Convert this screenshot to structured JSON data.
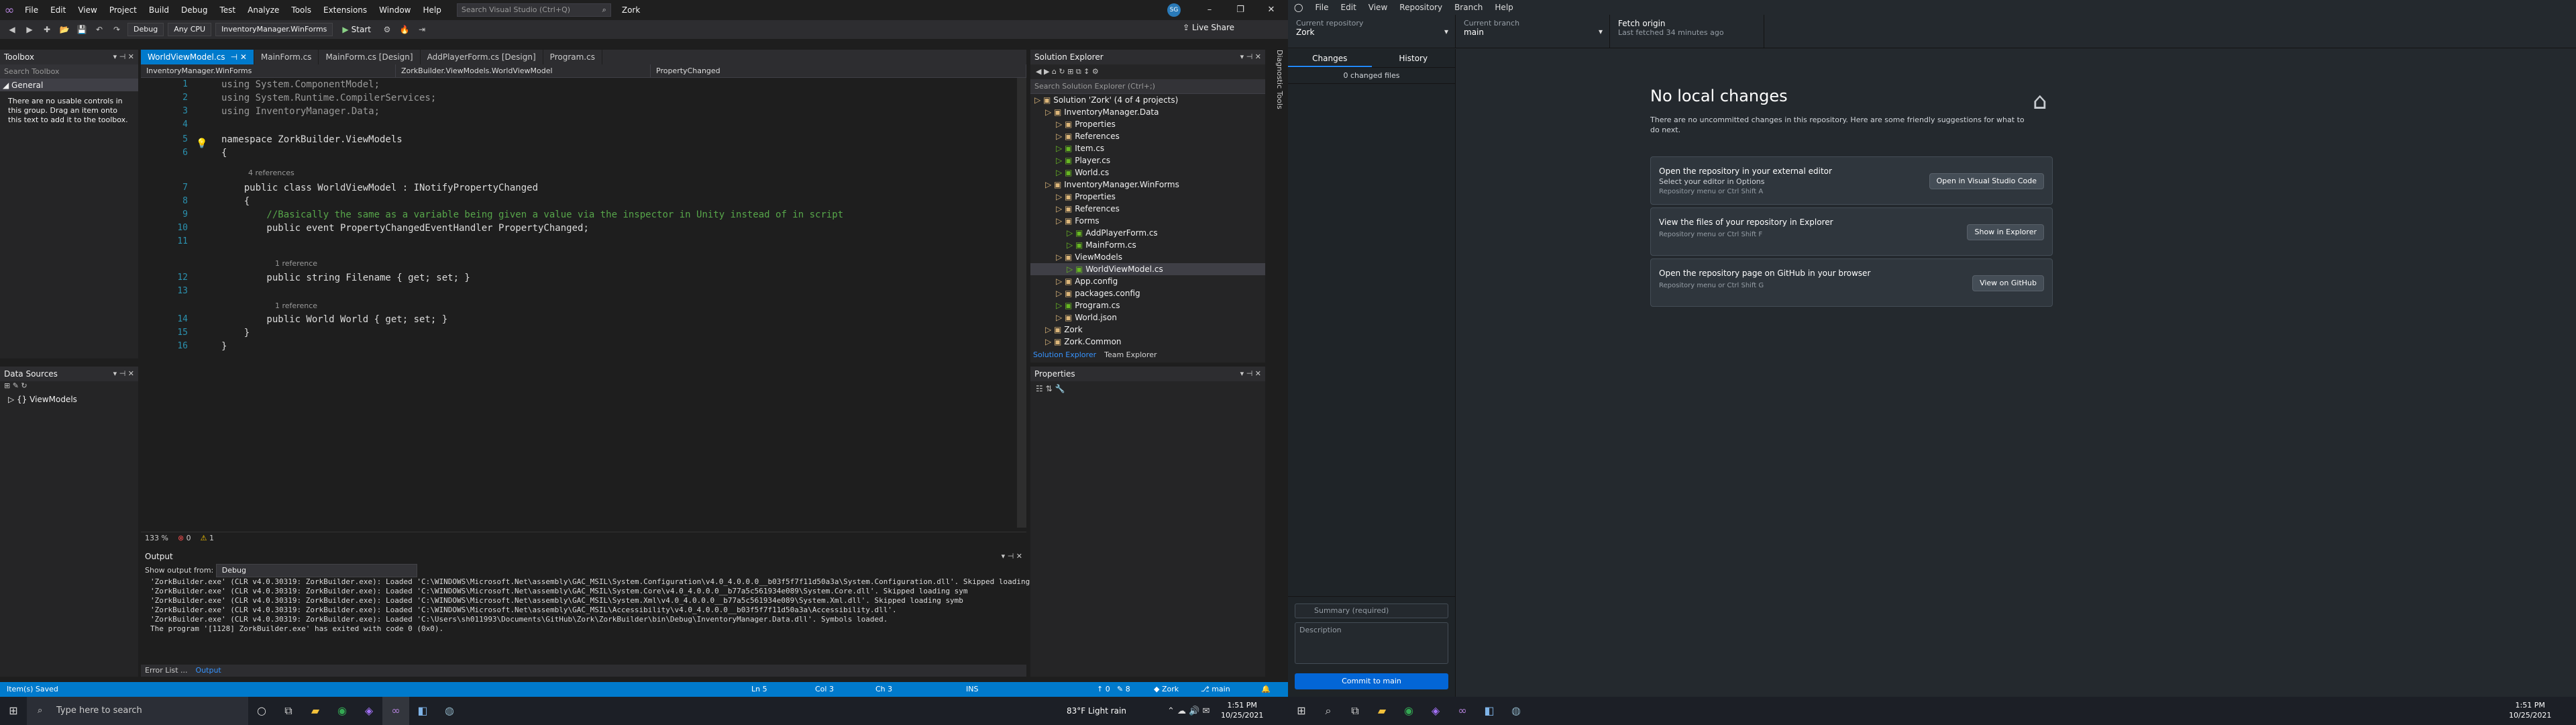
{
  "vs": {
    "menu": [
      "File",
      "Edit",
      "View",
      "Project",
      "Build",
      "Debug",
      "Test",
      "Analyze",
      "Tools",
      "Extensions",
      "Window",
      "Help"
    ],
    "search_placeholder": "Search Visual Studio (Ctrl+Q)",
    "solution_name": "Zork",
    "avatar_initials": "SG",
    "toolbar": {
      "config": "Debug",
      "platform": "Any CPU",
      "startup": "InventoryManager.WinForms",
      "start": "Start",
      "live_share": "Live Share"
    },
    "toolbox": {
      "title": "Toolbox",
      "search": "Search Toolbox",
      "group": "General",
      "empty": "There are no usable controls in this group. Drag an item onto this text to add it to the toolbox."
    },
    "data_sources": {
      "title": "Data Sources",
      "item": "ViewModels"
    },
    "tabs": [
      "WorldViewModel.cs",
      "MainForm.cs",
      "MainForm.cs [Design]",
      "AddPlayerForm.cs [Design]",
      "Program.cs"
    ],
    "nav": {
      "project": "InventoryManager.WinForms",
      "class": "ZorkBuilder.ViewModels.WorldViewModel",
      "member": "PropertyChanged"
    },
    "code": [
      {
        "n": "1",
        "t": "using System.ComponentModel;"
      },
      {
        "n": "2",
        "t": "using System.Runtime.CompilerServices;"
      },
      {
        "n": "3",
        "t": "using InventoryManager.Data;"
      },
      {
        "n": "4",
        "t": ""
      },
      {
        "n": "5",
        "t": "namespace ZorkBuilder.ViewModels"
      },
      {
        "n": "6",
        "t": "{"
      },
      {
        "n": "7",
        "t": "    public class WorldViewModel : INotifyPropertyChanged"
      },
      {
        "n": "8",
        "t": "    {"
      },
      {
        "n": "9",
        "t": "        //Basically the same as a variable being given a value via the inspector in Unity instead of in script"
      },
      {
        "n": "10",
        "t": "        public event PropertyChangedEventHandler PropertyChanged;"
      },
      {
        "n": "11",
        "t": ""
      },
      {
        "n": "12",
        "t": "        public string Filename { get; set; }"
      },
      {
        "n": "13",
        "t": ""
      },
      {
        "n": "14",
        "t": "        public World World { get; set; }"
      },
      {
        "n": "15",
        "t": "    }"
      },
      {
        "n": "16",
        "t": "}"
      }
    ],
    "codelens": {
      "refs4": "4 references",
      "ref1a": "1 reference",
      "ref1b": "1 reference"
    },
    "editor_status": {
      "zoom": "133 %",
      "errors": "0",
      "warnings": "1"
    },
    "output": {
      "title": "Output",
      "show_from": "Show output from:",
      "source": "Debug",
      "lines": [
        "'ZorkBuilder.exe' (CLR v4.0.30319: ZorkBuilder.exe): Loaded 'C:\\WINDOWS\\Microsoft.Net\\assembly\\GAC_MSIL\\System.Configuration\\v4.0_4.0.0.0__b03f5f7f11d50a3a\\System.Configuration.dll'. Skipped loading s",
        "'ZorkBuilder.exe' (CLR v4.0.30319: ZorkBuilder.exe): Loaded 'C:\\WINDOWS\\Microsoft.Net\\assembly\\GAC_MSIL\\System.Core\\v4.0_4.0.0.0__b77a5c561934e089\\System.Core.dll'. Skipped loading sym",
        "'ZorkBuilder.exe' (CLR v4.0.30319: ZorkBuilder.exe): Loaded 'C:\\WINDOWS\\Microsoft.Net\\assembly\\GAC_MSIL\\System.Xml\\v4.0_4.0.0.0__b77a5c561934e089\\System.Xml.dll'. Skipped loading symb",
        "'ZorkBuilder.exe' (CLR v4.0.30319: ZorkBuilder.exe): Loaded 'C:\\WINDOWS\\Microsoft.Net\\assembly\\GAC_MSIL\\Accessibility\\v4.0_4.0.0.0__b03f5f7f11d50a3a\\Accessibility.dll'.",
        "'ZorkBuilder.exe' (CLR v4.0.30319: ZorkBuilder.exe): Loaded 'C:\\Users\\sh011993\\Documents\\GitHub\\Zork\\ZorkBuilder\\bin\\Debug\\InventoryManager.Data.dll'. Symbols loaded.",
        "The program '[1128] ZorkBuilder.exe' has exited with code 0 (0x0)."
      ]
    },
    "bottom_tabs": [
      "Error List ...",
      "Output"
    ],
    "solution_explorer": {
      "title": "Solution Explorer",
      "search": "Search Solution Explorer (Ctrl+;)",
      "items": [
        {
          "label": "Solution 'Zork' (4 of 4 projects)",
          "indent": 0
        },
        {
          "label": "InventoryManager.Data",
          "indent": 1
        },
        {
          "label": "Properties",
          "indent": 2
        },
        {
          "label": "References",
          "indent": 2
        },
        {
          "label": "Item.cs",
          "indent": 2
        },
        {
          "label": "Player.cs",
          "indent": 2
        },
        {
          "label": "World.cs",
          "indent": 2
        },
        {
          "label": "InventoryManager.WinForms",
          "indent": 1
        },
        {
          "label": "Properties",
          "indent": 2
        },
        {
          "label": "References",
          "indent": 2
        },
        {
          "label": "Forms",
          "indent": 2
        },
        {
          "label": "AddPlayerForm.cs",
          "indent": 3
        },
        {
          "label": "MainForm.cs",
          "indent": 3
        },
        {
          "label": "ViewModels",
          "indent": 2
        },
        {
          "label": "WorldViewModel.cs",
          "indent": 3
        },
        {
          "label": "App.config",
          "indent": 2
        },
        {
          "label": "packages.config",
          "indent": 2
        },
        {
          "label": "Program.cs",
          "indent": 2
        },
        {
          "label": "World.json",
          "indent": 2
        },
        {
          "label": "Zork",
          "indent": 1
        },
        {
          "label": "Zork.Common",
          "indent": 1
        }
      ],
      "tabs": [
        "Solution Explorer",
        "Team Explorer"
      ]
    },
    "properties_title": "Properties",
    "side_tabs": [
      "Diagnostic Tools"
    ],
    "statusbar": {
      "left": "Item(s) Saved",
      "ln": "Ln 5",
      "col": "Col 3",
      "ch": "Ch 3",
      "ins": "INS",
      "up": "0",
      "pencil": "8",
      "repo": "Zork",
      "branch": "main"
    }
  },
  "gh": {
    "menu": [
      "File",
      "Edit",
      "View",
      "Repository",
      "Branch",
      "Help"
    ],
    "repo_label": "Current repository",
    "repo": "Zork",
    "branch_label": "Current branch",
    "branch": "main",
    "fetch": "Fetch origin",
    "fetch_sub": "Last fetched 34 minutes ago",
    "tabs": [
      "Changes",
      "History"
    ],
    "changed": "0 changed files",
    "summary_ph": "Summary (required)",
    "desc_ph": "Description",
    "commit": "Commit to main",
    "heading": "No local changes",
    "sub": "There are no uncommitted changes in this repository. Here are some friendly suggestions for what to do next.",
    "cards": [
      {
        "title": "Open the repository in your external editor",
        "sub": "Select your editor in Options",
        "keys": "Repository menu or  Ctrl  Shift  A",
        "btn": "Open in Visual Studio Code"
      },
      {
        "title": "View the files of your repository in Explorer",
        "sub": "",
        "keys": "Repository menu or  Ctrl  Shift  F",
        "btn": "Show in Explorer"
      },
      {
        "title": "Open the repository page on GitHub in your browser",
        "sub": "",
        "keys": "Repository menu or  Ctrl  Shift  G",
        "btn": "View on GitHub"
      }
    ]
  },
  "taskbar": {
    "search": "Type here to search",
    "weather": "83°F  Light rain",
    "time": "1:51 PM",
    "date": "10/25/2021"
  },
  "colors": {
    "vs_accent": "#007acc",
    "gh_bg": "#24292e",
    "commit": "#0366d6"
  }
}
